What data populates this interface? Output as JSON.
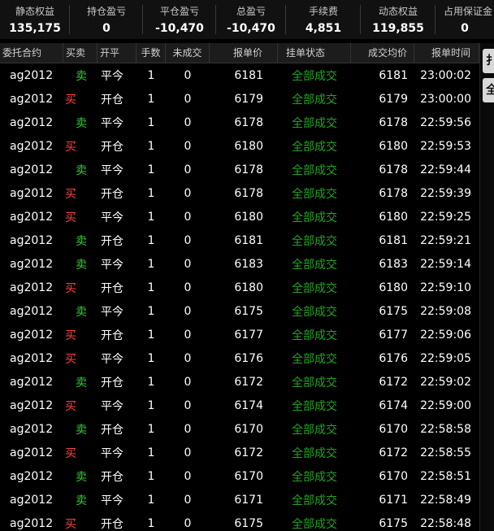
{
  "summary": [
    {
      "label": "静态权益",
      "value": "135,175"
    },
    {
      "label": "持仓盈亏",
      "value": "0"
    },
    {
      "label": "平仓盈亏",
      "value": "-10,470"
    },
    {
      "label": "总盈亏",
      "value": "-10,470"
    },
    {
      "label": "手续费",
      "value": "4,851"
    },
    {
      "label": "动态权益",
      "value": "119,855"
    },
    {
      "label": "占用保证金",
      "value": "0"
    }
  ],
  "table": {
    "headers": [
      "委托合约",
      "买卖",
      "开平",
      "手数",
      "未成交",
      "报单价",
      "挂单状态",
      "成交均价",
      "报单时间"
    ],
    "rows": [
      {
        "contract": "ag2012",
        "side": "卖",
        "offset": "平今",
        "lots": "1",
        "unfilled": "0",
        "price": "6181",
        "status": "全部成交",
        "avg": "6181",
        "time": "23:00:02"
      },
      {
        "contract": "ag2012",
        "side": "买",
        "offset": "开仓",
        "lots": "1",
        "unfilled": "0",
        "price": "6179",
        "status": "全部成交",
        "avg": "6179",
        "time": "23:00:00"
      },
      {
        "contract": "ag2012",
        "side": "卖",
        "offset": "平今",
        "lots": "1",
        "unfilled": "0",
        "price": "6178",
        "status": "全部成交",
        "avg": "6178",
        "time": "22:59:56"
      },
      {
        "contract": "ag2012",
        "side": "买",
        "offset": "开仓",
        "lots": "1",
        "unfilled": "0",
        "price": "6180",
        "status": "全部成交",
        "avg": "6180",
        "time": "22:59:53"
      },
      {
        "contract": "ag2012",
        "side": "卖",
        "offset": "平今",
        "lots": "1",
        "unfilled": "0",
        "price": "6178",
        "status": "全部成交",
        "avg": "6178",
        "time": "22:59:44"
      },
      {
        "contract": "ag2012",
        "side": "买",
        "offset": "开仓",
        "lots": "1",
        "unfilled": "0",
        "price": "6178",
        "status": "全部成交",
        "avg": "6178",
        "time": "22:59:39"
      },
      {
        "contract": "ag2012",
        "side": "买",
        "offset": "平今",
        "lots": "1",
        "unfilled": "0",
        "price": "6180",
        "status": "全部成交",
        "avg": "6180",
        "time": "22:59:25"
      },
      {
        "contract": "ag2012",
        "side": "卖",
        "offset": "开仓",
        "lots": "1",
        "unfilled": "0",
        "price": "6181",
        "status": "全部成交",
        "avg": "6181",
        "time": "22:59:21"
      },
      {
        "contract": "ag2012",
        "side": "卖",
        "offset": "平今",
        "lots": "1",
        "unfilled": "0",
        "price": "6183",
        "status": "全部成交",
        "avg": "6183",
        "time": "22:59:14"
      },
      {
        "contract": "ag2012",
        "side": "买",
        "offset": "开仓",
        "lots": "1",
        "unfilled": "0",
        "price": "6180",
        "status": "全部成交",
        "avg": "6180",
        "time": "22:59:10"
      },
      {
        "contract": "ag2012",
        "side": "卖",
        "offset": "平今",
        "lots": "1",
        "unfilled": "0",
        "price": "6175",
        "status": "全部成交",
        "avg": "6175",
        "time": "22:59:08"
      },
      {
        "contract": "ag2012",
        "side": "买",
        "offset": "开仓",
        "lots": "1",
        "unfilled": "0",
        "price": "6177",
        "status": "全部成交",
        "avg": "6177",
        "time": "22:59:06"
      },
      {
        "contract": "ag2012",
        "side": "买",
        "offset": "平今",
        "lots": "1",
        "unfilled": "0",
        "price": "6176",
        "status": "全部成交",
        "avg": "6176",
        "time": "22:59:05"
      },
      {
        "contract": "ag2012",
        "side": "卖",
        "offset": "开仓",
        "lots": "1",
        "unfilled": "0",
        "price": "6172",
        "status": "全部成交",
        "avg": "6172",
        "time": "22:59:02"
      },
      {
        "contract": "ag2012",
        "side": "买",
        "offset": "平今",
        "lots": "1",
        "unfilled": "0",
        "price": "6174",
        "status": "全部成交",
        "avg": "6174",
        "time": "22:59:00"
      },
      {
        "contract": "ag2012",
        "side": "卖",
        "offset": "开仓",
        "lots": "1",
        "unfilled": "0",
        "price": "6170",
        "status": "全部成交",
        "avg": "6170",
        "time": "22:58:58"
      },
      {
        "contract": "ag2012",
        "side": "买",
        "offset": "平今",
        "lots": "1",
        "unfilled": "0",
        "price": "6172",
        "status": "全部成交",
        "avg": "6172",
        "time": "22:58:55"
      },
      {
        "contract": "ag2012",
        "side": "卖",
        "offset": "开仓",
        "lots": "1",
        "unfilled": "0",
        "price": "6170",
        "status": "全部成交",
        "avg": "6170",
        "time": "22:58:51"
      },
      {
        "contract": "ag2012",
        "side": "卖",
        "offset": "平今",
        "lots": "1",
        "unfilled": "0",
        "price": "6171",
        "status": "全部成交",
        "avg": "6171",
        "time": "22:58:49"
      },
      {
        "contract": "ag2012",
        "side": "买",
        "offset": "开仓",
        "lots": "1",
        "unfilled": "0",
        "price": "6175",
        "status": "全部成交",
        "avg": "6175",
        "time": "22:58:48"
      }
    ]
  },
  "side_buttons": [
    "扌",
    "全"
  ],
  "colors": {
    "buy": "#ff4040",
    "sell": "#34c934",
    "filled": "#25a225"
  }
}
